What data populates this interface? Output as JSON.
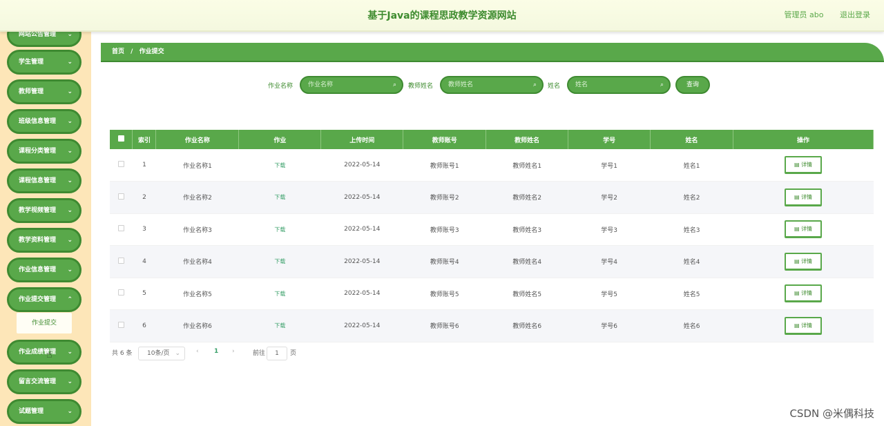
{
  "header": {
    "title": "基于Java的课程思政教学资源网站",
    "role_user": "管理员 abo",
    "logout": "退出登录"
  },
  "sidebar": {
    "items": [
      {
        "label": "网站公告管理"
      },
      {
        "label": "学生管理"
      },
      {
        "label": "教师管理"
      },
      {
        "label": "班级信息管理"
      },
      {
        "label": "课程分类管理"
      },
      {
        "label": "课程信息管理"
      },
      {
        "label": "教学视频管理"
      },
      {
        "label": "教学资料管理"
      },
      {
        "label": "作业信息管理"
      },
      {
        "label": "作业提交管理"
      },
      {
        "label": "作业成绩管理"
      },
      {
        "label": "留言交流管理"
      },
      {
        "label": "试题管理"
      }
    ],
    "submenu_active": "作业提交",
    "chevron": "chevron-down-icon"
  },
  "breadcrumb": {
    "home": "首页",
    "sep": "/",
    "current": "作业提交"
  },
  "search": {
    "label1": "作业名称",
    "placeholder1": "作业名称",
    "label2": "教师姓名",
    "placeholder2": "教师姓名",
    "label3": "姓名",
    "placeholder3": "姓名",
    "button": "查询"
  },
  "table": {
    "headers": [
      "索引",
      "作业名称",
      "作业",
      "上传时间",
      "教师账号",
      "教师姓名",
      "学号",
      "姓名",
      "操作"
    ],
    "rows": [
      {
        "idx": "1",
        "name": "作业名称1",
        "file": "下载",
        "time": "2022-05-14",
        "tacct": "教师账号1",
        "tname": "教师姓名1",
        "sno": "学号1",
        "sname": "姓名1",
        "action": "详情"
      },
      {
        "idx": "2",
        "name": "作业名称2",
        "file": "下载",
        "time": "2022-05-14",
        "tacct": "教师账号2",
        "tname": "教师姓名2",
        "sno": "学号2",
        "sname": "姓名2",
        "action": "详情"
      },
      {
        "idx": "3",
        "name": "作业名称3",
        "file": "下载",
        "time": "2022-05-14",
        "tacct": "教师账号3",
        "tname": "教师姓名3",
        "sno": "学号3",
        "sname": "姓名3",
        "action": "详情"
      },
      {
        "idx": "4",
        "name": "作业名称4",
        "file": "下载",
        "time": "2022-05-14",
        "tacct": "教师账号4",
        "tname": "教师姓名4",
        "sno": "学号4",
        "sname": "姓名4",
        "action": "详情"
      },
      {
        "idx": "5",
        "name": "作业名称5",
        "file": "下载",
        "time": "2022-05-14",
        "tacct": "教师账号5",
        "tname": "教师姓名5",
        "sno": "学号5",
        "sname": "姓名5",
        "action": "详情"
      },
      {
        "idx": "6",
        "name": "作业名称6",
        "file": "下载",
        "time": "2022-05-14",
        "tacct": "教师账号6",
        "tname": "教师姓名6",
        "sno": "学号6",
        "sname": "姓名6",
        "action": "详情"
      }
    ]
  },
  "pager": {
    "total": "共 6 条",
    "page_size": "10条/页",
    "current_page": "1",
    "goto_label": "前往",
    "goto_value": "1",
    "goto_suffix": "页"
  },
  "colors": {
    "primary": "#59a84a",
    "primary_dark": "#3e8a31",
    "sidebar_bg": "#fde6b8",
    "header_bg": "#fbfde6"
  },
  "watermark": "CSDN @米偶科技"
}
